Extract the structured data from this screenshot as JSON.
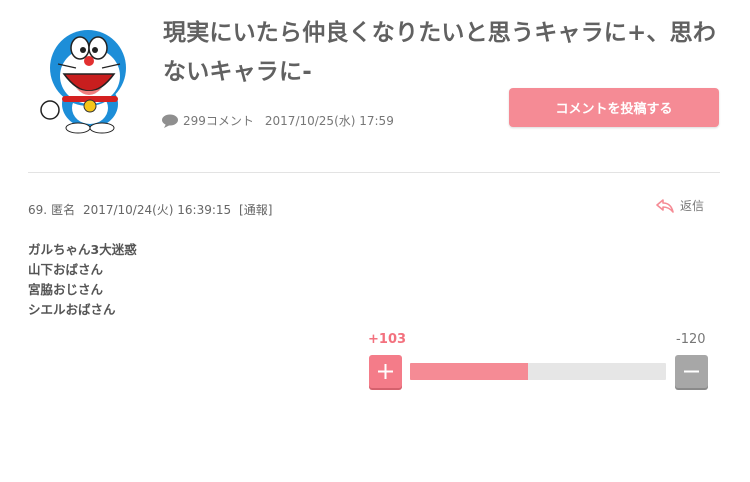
{
  "topic": {
    "title": "現実にいたら仲良くなりたいと思うキャラに+、思わないキャラに-",
    "comment_count": "299コメント",
    "date": "2017/10/25(水) 17:59",
    "post_button": "コメントを投稿する",
    "thumbnail_icon": "doraemon-character-image"
  },
  "comment": {
    "number": "69.",
    "author": "匿名",
    "datetime": "2017/10/24(火) 16:39:15",
    "report": "[通報]",
    "reply_label": "返信",
    "lines": [
      "ガルちゃん3大迷惑",
      "山下おばさん",
      "宮脇おじさん",
      "シエルおばさん"
    ],
    "plus_count": "+103",
    "minus_count": "-120",
    "plus_ratio": 0.462
  },
  "colors": {
    "accent": "#f58b95",
    "plus_text": "#f3717e",
    "minus_button": "#a7a7a7"
  }
}
